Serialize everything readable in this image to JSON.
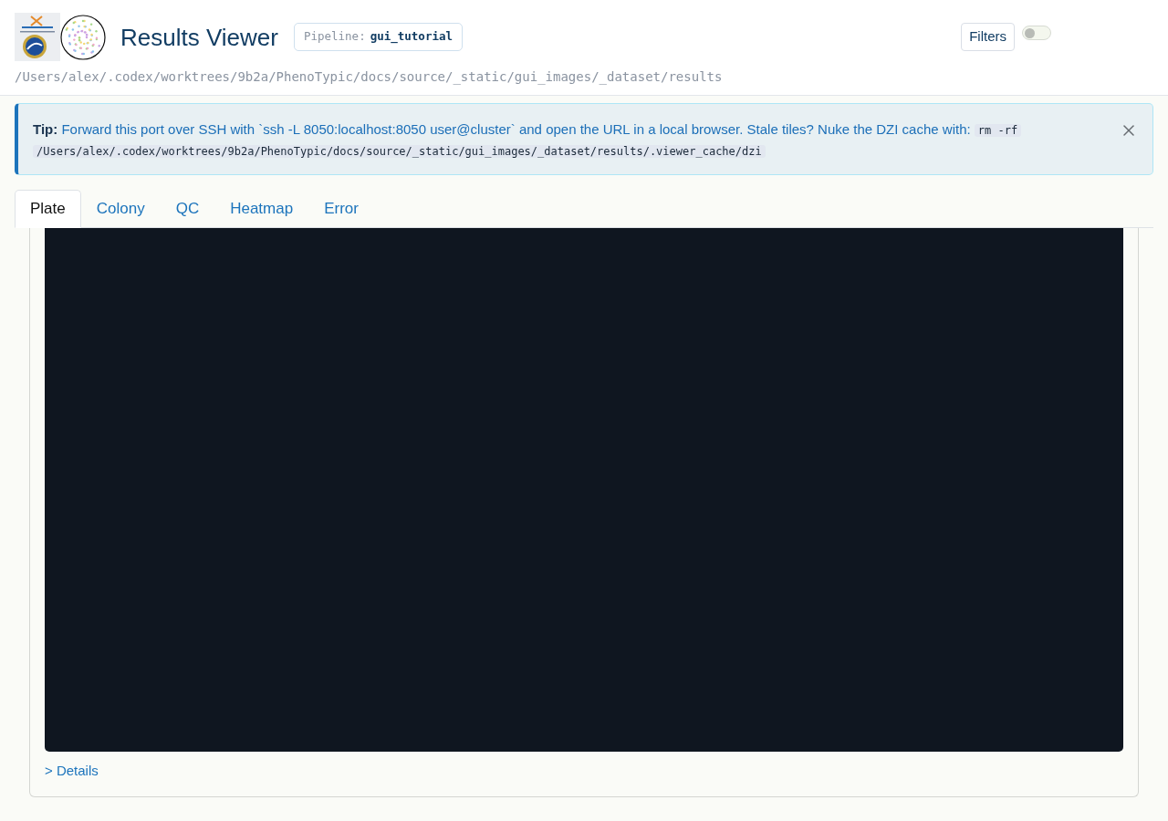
{
  "header": {
    "title": "Results Viewer",
    "pipeline": {
      "label": "Pipeline:",
      "value": "gui_tutorial"
    },
    "path": "/Users/alex/.codex/worktrees/9b2a/PhenoTypic/docs/source/_static/gui_images/_dataset/results",
    "filters_button": "Filters",
    "filters_toggle": {
      "on": false
    }
  },
  "alert": {
    "label": "Tip:",
    "message": "Forward this port over SSH with `ssh -L 8050:localhost:8050 user@cluster` and open the URL in a local browser. Stale tiles? Nuke the DZI cache with:",
    "command": "rm -rf /Users/alex/.codex/worktrees/9b2a/PhenoTypic/docs/source/_static/gui_images/_dataset/results/.viewer_cache/dzi"
  },
  "tabs": [
    {
      "label": "Plate",
      "selected": true
    },
    {
      "label": "Colony",
      "selected": false
    },
    {
      "label": "QC",
      "selected": false
    },
    {
      "label": "Heatmap",
      "selected": false
    },
    {
      "label": "Error",
      "selected": false
    }
  ],
  "panel": {
    "details_link": "> Details"
  }
}
